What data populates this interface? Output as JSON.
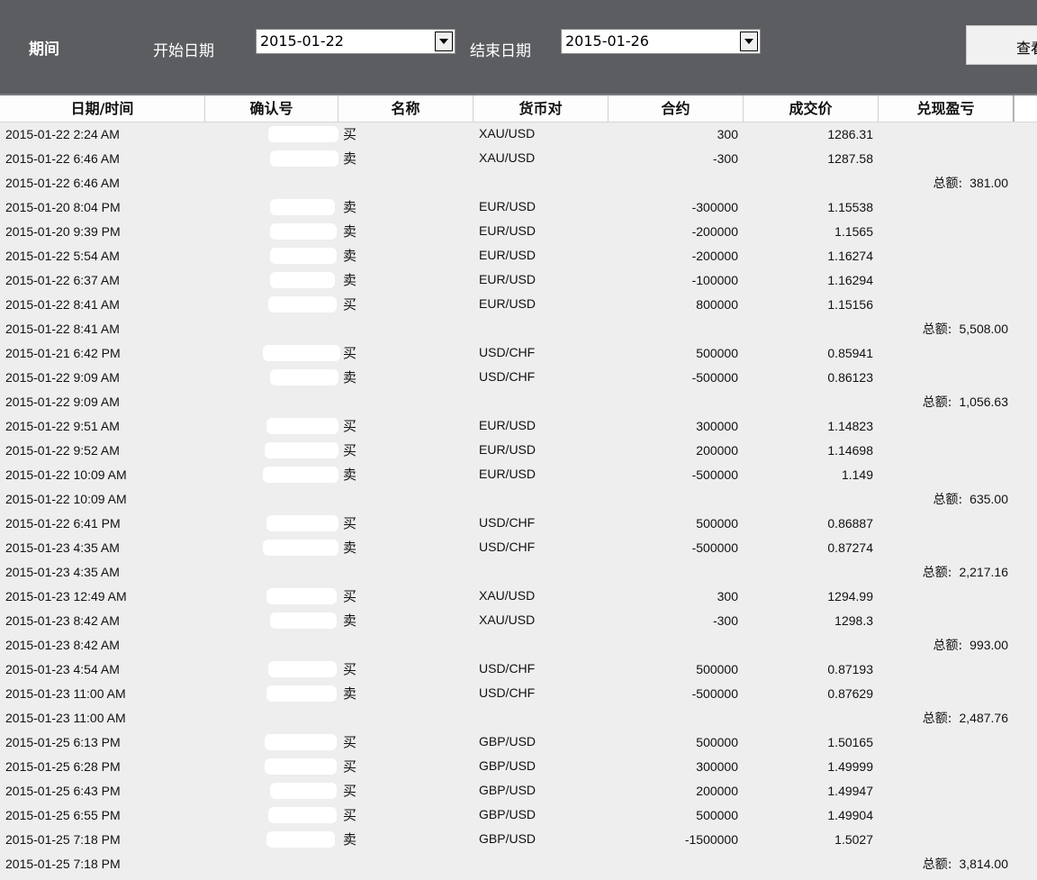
{
  "filter": {
    "period_label": "期间",
    "start_label": "开始日期",
    "start_value": "2015-01-22",
    "end_label": "结束日期",
    "end_value": "2015-01-26",
    "query_button": "查看"
  },
  "table": {
    "columns": [
      "日期/时间",
      "确认号",
      "名称",
      "货币对",
      "合约",
      "成交价",
      "兑现盈亏"
    ],
    "total_label": "总额:",
    "rows": [
      {
        "datetime": "2015-01-22 2:24 AM",
        "side": "买",
        "pair": "XAU/USD",
        "qty": "300",
        "price": "1286.31",
        "total": ""
      },
      {
        "datetime": "2015-01-22 6:46 AM",
        "side": "卖",
        "pair": "XAU/USD",
        "qty": "-300",
        "price": "1287.58",
        "total": ""
      },
      {
        "datetime": "2015-01-22 6:46 AM",
        "side": "",
        "pair": "",
        "qty": "",
        "price": "",
        "total": "381.00"
      },
      {
        "datetime": "2015-01-20 8:04 PM",
        "side": "卖",
        "pair": "EUR/USD",
        "qty": "-300000",
        "price": "1.15538",
        "total": ""
      },
      {
        "datetime": "2015-01-20 9:39 PM",
        "side": "卖",
        "pair": "EUR/USD",
        "qty": "-200000",
        "price": "1.1565",
        "total": ""
      },
      {
        "datetime": "2015-01-22 5:54 AM",
        "side": "卖",
        "pair": "EUR/USD",
        "qty": "-200000",
        "price": "1.16274",
        "total": ""
      },
      {
        "datetime": "2015-01-22 6:37 AM",
        "side": "卖",
        "pair": "EUR/USD",
        "qty": "-100000",
        "price": "1.16294",
        "total": ""
      },
      {
        "datetime": "2015-01-22 8:41 AM",
        "side": "买",
        "pair": "EUR/USD",
        "qty": "800000",
        "price": "1.15156",
        "total": ""
      },
      {
        "datetime": "2015-01-22 8:41 AM",
        "side": "",
        "pair": "",
        "qty": "",
        "price": "",
        "total": "5,508.00"
      },
      {
        "datetime": "2015-01-21 6:42 PM",
        "side": "买",
        "pair": "USD/CHF",
        "qty": "500000",
        "price": "0.85941",
        "total": ""
      },
      {
        "datetime": "2015-01-22 9:09 AM",
        "side": "卖",
        "pair": "USD/CHF",
        "qty": "-500000",
        "price": "0.86123",
        "total": ""
      },
      {
        "datetime": "2015-01-22 9:09 AM",
        "side": "",
        "pair": "",
        "qty": "",
        "price": "",
        "total": "1,056.63"
      },
      {
        "datetime": "2015-01-22 9:51 AM",
        "side": "买",
        "pair": "EUR/USD",
        "qty": "300000",
        "price": "1.14823",
        "total": ""
      },
      {
        "datetime": "2015-01-22 9:52 AM",
        "side": "买",
        "pair": "EUR/USD",
        "qty": "200000",
        "price": "1.14698",
        "total": ""
      },
      {
        "datetime": "2015-01-22 10:09 AM",
        "side": "卖",
        "pair": "EUR/USD",
        "qty": "-500000",
        "price": "1.149",
        "total": ""
      },
      {
        "datetime": "2015-01-22 10:09 AM",
        "side": "",
        "pair": "",
        "qty": "",
        "price": "",
        "total": "635.00"
      },
      {
        "datetime": "2015-01-22 6:41 PM",
        "side": "买",
        "pair": "USD/CHF",
        "qty": "500000",
        "price": "0.86887",
        "total": ""
      },
      {
        "datetime": "2015-01-23 4:35 AM",
        "side": "卖",
        "pair": "USD/CHF",
        "qty": "-500000",
        "price": "0.87274",
        "total": ""
      },
      {
        "datetime": "2015-01-23 4:35 AM",
        "side": "",
        "pair": "",
        "qty": "",
        "price": "",
        "total": "2,217.16"
      },
      {
        "datetime": "2015-01-23 12:49 AM",
        "side": "买",
        "pair": "XAU/USD",
        "qty": "300",
        "price": "1294.99",
        "total": ""
      },
      {
        "datetime": "2015-01-23 8:42 AM",
        "side": "卖",
        "pair": "XAU/USD",
        "qty": "-300",
        "price": "1298.3",
        "total": ""
      },
      {
        "datetime": "2015-01-23 8:42 AM",
        "side": "",
        "pair": "",
        "qty": "",
        "price": "",
        "total": "993.00"
      },
      {
        "datetime": "2015-01-23 4:54 AM",
        "side": "买",
        "pair": "USD/CHF",
        "qty": "500000",
        "price": "0.87193",
        "total": ""
      },
      {
        "datetime": "2015-01-23 11:00 AM",
        "side": "卖",
        "pair": "USD/CHF",
        "qty": "-500000",
        "price": "0.87629",
        "total": ""
      },
      {
        "datetime": "2015-01-23 11:00 AM",
        "side": "",
        "pair": "",
        "qty": "",
        "price": "",
        "total": "2,487.76"
      },
      {
        "datetime": "2015-01-25 6:13 PM",
        "side": "买",
        "pair": "GBP/USD",
        "qty": "500000",
        "price": "1.50165",
        "total": ""
      },
      {
        "datetime": "2015-01-25 6:28 PM",
        "side": "买",
        "pair": "GBP/USD",
        "qty": "300000",
        "price": "1.49999",
        "total": ""
      },
      {
        "datetime": "2015-01-25 6:43 PM",
        "side": "买",
        "pair": "GBP/USD",
        "qty": "200000",
        "price": "1.49947",
        "total": ""
      },
      {
        "datetime": "2015-01-25 6:55 PM",
        "side": "买",
        "pair": "GBP/USD",
        "qty": "500000",
        "price": "1.49904",
        "total": ""
      },
      {
        "datetime": "2015-01-25 7:18 PM",
        "side": "卖",
        "pair": "GBP/USD",
        "qty": "-1500000",
        "price": "1.5027",
        "total": ""
      },
      {
        "datetime": "2015-01-25 7:18 PM",
        "side": "",
        "pair": "",
        "qty": "",
        "price": "",
        "total": "3,814.00"
      }
    ]
  }
}
